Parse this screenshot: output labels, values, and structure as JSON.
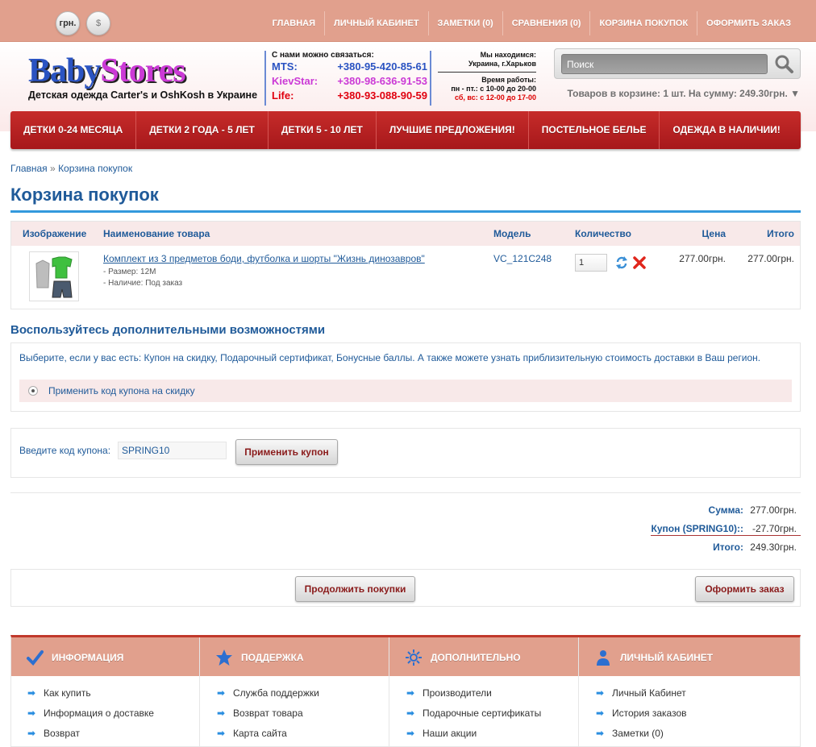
{
  "currency": {
    "uah": "грн.",
    "usd": "$"
  },
  "topnav": [
    "Главная",
    "Личный кабинет",
    "Заметки (0)",
    "Сравнения (0)",
    "Корзина покупок",
    "Оформить заказ"
  ],
  "header": {
    "logo_part1": "Baby",
    "logo_part2": "Stores",
    "tagline": "Детская одежда Carter's и OshKosh в Украине",
    "contacts_title": "С нами можно связаться:",
    "phones": [
      {
        "op": "MTS:",
        "num": "+380-95-420-85-61"
      },
      {
        "op": "KievStar:",
        "num": "+380-98-636-91-53"
      },
      {
        "op": "Life:",
        "num": "+380-93-088-90-59"
      }
    ],
    "location_title": "Мы находимся:",
    "location_city": "Украина, г.Харьков",
    "hours_title": "Время работы:",
    "hours_weekdays": "пн - пт.: с 10-00 до 20-00",
    "hours_weekend": "сб, вс: с 12-00 до 17-00",
    "search_placeholder": "Поиск",
    "cart_summary": "Товаров в корзине: 1 шт. На сумму: 249.30грн. ▼"
  },
  "mainnav": [
    "Детки 0-24 месяца",
    "Детки 2 года - 5 лет",
    "Детки 5 - 10 лет",
    "Лучшие предложения!",
    "Постельное белье",
    "Одежда в наличии!"
  ],
  "breadcrumb": {
    "home": "Главная",
    "sep": "»",
    "current": "Корзина покупок"
  },
  "page_title": "Корзина покупок",
  "cart": {
    "headers": {
      "image": "Изображение",
      "name": "Наименование товара",
      "model": "Модель",
      "qty": "Количество",
      "price": "Цена",
      "total": "Итого"
    },
    "item": {
      "name": "Комплект из 3 предметов боди, футболка и шорты \"Жизнь динозавров\"",
      "size": "- Размер: 12M",
      "availability": "- Наличие: Под заказ",
      "model": "VC_121C248",
      "qty": "1",
      "price": "277.00грн.",
      "total": "277.00грн."
    }
  },
  "options": {
    "title": "Воспользуйтесь дополнительными возможностями",
    "desc": "Выберите, если у вас есть: Купон на скидку, Подарочный сертификат, Бонусные баллы. А также можете узнать приблизительную стоимость доставки в Ваш регион.",
    "coupon_option": "Применить код купона на скидку"
  },
  "coupon": {
    "label": "Введите код купона:",
    "value": "SPRING10",
    "button": "Применить купон"
  },
  "totals": {
    "sum_label": "Сумма:",
    "sum_value": "277.00грн.",
    "coupon_label": "Купон (SPRING10)::",
    "coupon_value": "-27.70грн.",
    "total_label": "Итого:",
    "total_value": "249.30грн."
  },
  "actions": {
    "continue": "Продолжить покупки",
    "checkout": "Оформить заказ"
  },
  "footer": [
    {
      "title": "Информация",
      "links": [
        "Как купить",
        "Информация о доставке",
        "Возврат"
      ]
    },
    {
      "title": "Поддержка",
      "links": [
        "Служба поддержки",
        "Возврат товара",
        "Карта сайта"
      ]
    },
    {
      "title": "Дополнительно",
      "links": [
        "Производители",
        "Подарочные сертификаты",
        "Наши акции"
      ]
    },
    {
      "title": "Личный Кабинет",
      "links": [
        "Личный Кабинет",
        "История заказов",
        "Заметки (0)"
      ]
    }
  ],
  "colors": {
    "accent_blue": "#1f5a99",
    "nav_red": "#b3201f",
    "top_salmon": "#e1a08d"
  }
}
